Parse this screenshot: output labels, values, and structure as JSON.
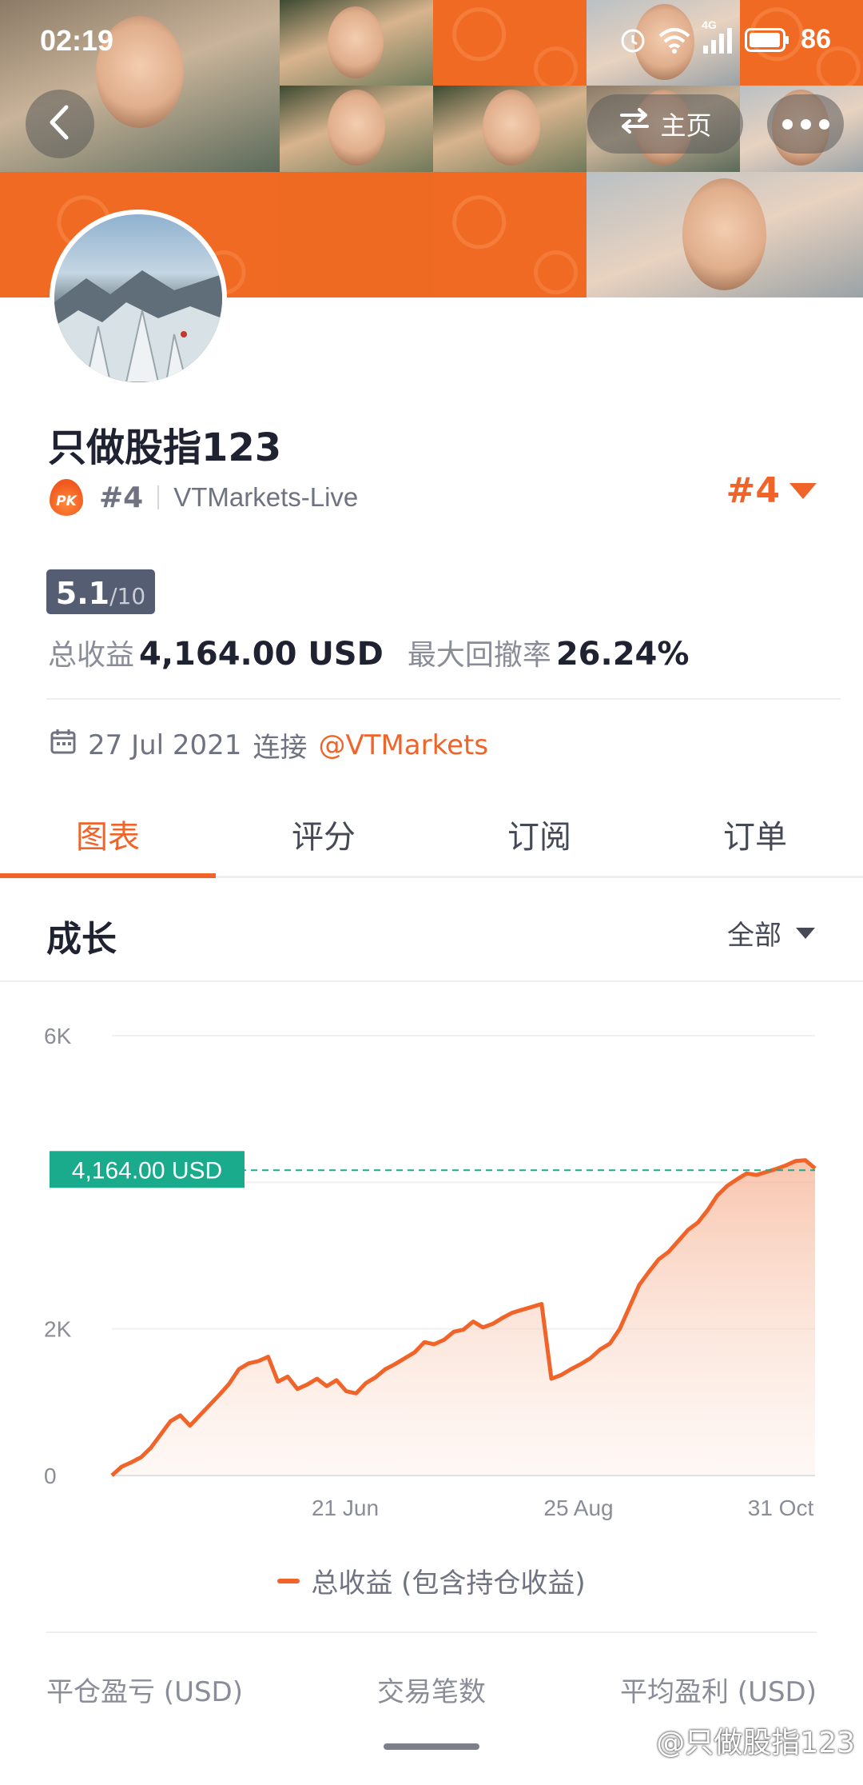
{
  "status_bar": {
    "time": "02:19",
    "network": "4G",
    "battery": "86"
  },
  "header": {
    "home_label": "主页"
  },
  "profile": {
    "name": "只做股指123",
    "pk_badge": "PK",
    "rank": "#4",
    "server": "VTMarkets-Live",
    "rank_right": "#4",
    "score": {
      "value": "5.1",
      "max": "/10"
    },
    "total_profit_label": "总收益",
    "total_profit_value": "4,164.00 USD",
    "max_drawdown_label": "最大回撤率",
    "max_drawdown_value": "26.24%",
    "joined_date": "27 Jul 2021",
    "joined_text": "连接",
    "broker_link": "@VTMarkets"
  },
  "tabs": [
    {
      "label": "图表",
      "active": true
    },
    {
      "label": "评分",
      "active": false
    },
    {
      "label": "订阅",
      "active": false
    },
    {
      "label": "订单",
      "active": false
    }
  ],
  "growth": {
    "title": "成长",
    "filter": "全部"
  },
  "chart_data": {
    "type": "area",
    "title": "",
    "xlabel": "",
    "ylabel": "",
    "x_ticks": [
      "21 Jun",
      "25 Aug",
      "31 Oct"
    ],
    "y_ticks": [
      "0",
      "2K",
      "6K"
    ],
    "ylim": [
      0,
      6000
    ],
    "current_value_label": "4,164.00 USD",
    "current_value": 4164,
    "series": [
      {
        "name": "总收益 (包含持仓收益)",
        "color": "#f0642a",
        "values": [
          0,
          120,
          180,
          250,
          380,
          560,
          740,
          820,
          680,
          820,
          960,
          1100,
          1250,
          1450,
          1530,
          1560,
          1620,
          1280,
          1350,
          1180,
          1240,
          1320,
          1220,
          1300,
          1150,
          1120,
          1260,
          1340,
          1450,
          1520,
          1600,
          1680,
          1820,
          1790,
          1850,
          1960,
          1990,
          2100,
          2020,
          2070,
          2150,
          2220,
          2260,
          2300,
          2340,
          1320,
          1370,
          1450,
          1520,
          1600,
          1720,
          1800,
          2000,
          2300,
          2600,
          2780,
          2950,
          3050,
          3200,
          3350,
          3450,
          3620,
          3820,
          3950,
          4040,
          4120,
          4100,
          4140,
          4180,
          4230,
          4290,
          4300,
          4190
        ]
      }
    ],
    "grid": true,
    "legend_position": "bottom"
  },
  "bottom_stats": [
    "平仓盈亏 (USD)",
    "交易笔数",
    "平均盈利 (USD)"
  ],
  "watermark": "@只做股指123",
  "colors": {
    "accent": "#f0642a",
    "teal": "#1aaa8c",
    "score_bg": "#545d72"
  }
}
